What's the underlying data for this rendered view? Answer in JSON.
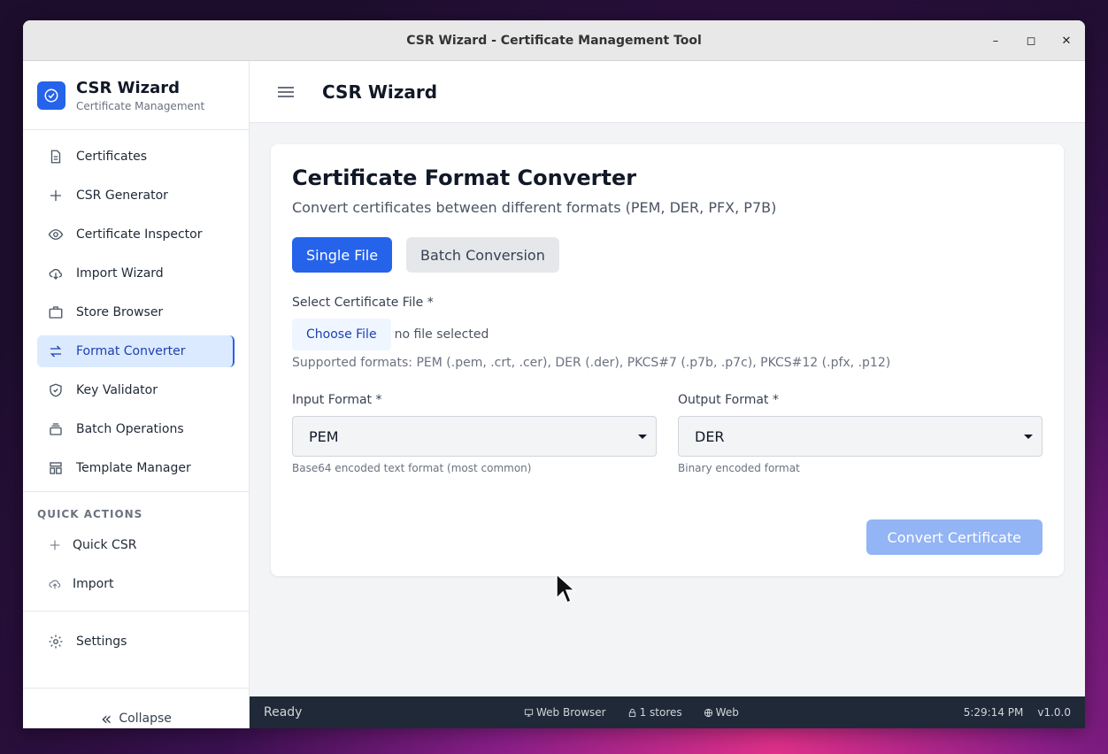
{
  "window": {
    "title": "CSR Wizard - Certificate Management Tool",
    "controls": [
      "–",
      "◻",
      "✕"
    ]
  },
  "sidebar": {
    "brand_name": "CSR Wizard",
    "brand_sub": "Certificate Management",
    "items": [
      {
        "label": "Certificates",
        "icon": "document-icon"
      },
      {
        "label": "CSR Generator",
        "icon": "plus-icon"
      },
      {
        "label": "Certificate Inspector",
        "icon": "eye-icon"
      },
      {
        "label": "Import Wizard",
        "icon": "cloud-download-icon"
      },
      {
        "label": "Store Browser",
        "icon": "briefcase-icon"
      },
      {
        "label": "Format Converter",
        "icon": "swap-icon",
        "active": true
      },
      {
        "label": "Key Validator",
        "icon": "shield-check-icon"
      },
      {
        "label": "Batch Operations",
        "icon": "stack-icon"
      },
      {
        "label": "Template Manager",
        "icon": "template-icon"
      }
    ],
    "quick_actions_title": "QUICK ACTIONS",
    "quick_actions": [
      {
        "label": "Quick CSR",
        "icon": "plus-icon"
      },
      {
        "label": "Import",
        "icon": "cloud-upload-icon"
      }
    ],
    "settings_label": "Settings",
    "collapse_label": "Collapse",
    "collapse_arrow": "«"
  },
  "header": {
    "title": "CSR Wizard"
  },
  "converter": {
    "title": "Certificate Format Converter",
    "subtitle": "Convert certificates between different formats (PEM, DER, PFX, P7B)",
    "tabs": [
      {
        "label": "Single File",
        "active": true
      },
      {
        "label": "Batch Conversion",
        "active": false
      }
    ],
    "file_label": "Select Certificate File *",
    "choose_button": "Choose File",
    "file_status": "no file selected",
    "supported_formats": "Supported formats: PEM (.pem, .crt, .cer), DER (.der), PKCS#7 (.p7b, .p7c), PKCS#12 (.pfx, .p12)",
    "input_label": "Input Format *",
    "input_value": "PEM",
    "input_hint": "Base64 encoded text format (most common)",
    "output_label": "Output Format *",
    "output_value": "DER",
    "output_hint": "Binary encoded format",
    "convert_button": "Convert Certificate"
  },
  "status": {
    "state": "Ready",
    "platform": "Web Browser",
    "stores": "1 stores",
    "mode": "Web",
    "time": "5:29:14 PM",
    "version": "v1.0.0"
  },
  "colors": {
    "accent": "#2563eb",
    "active_bg": "#dbeafe",
    "statusbar": "#1f2937"
  }
}
